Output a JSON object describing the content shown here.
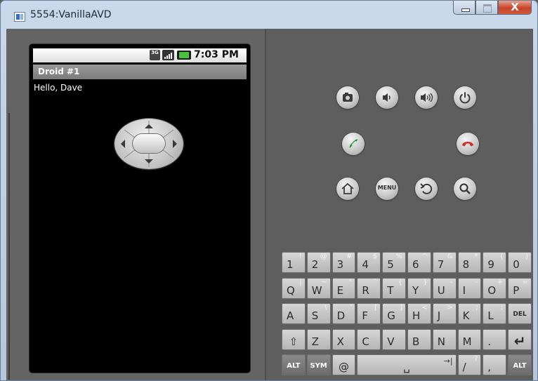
{
  "window": {
    "title": "5554:VanillaAVD",
    "close_glyph": "X",
    "controls": [
      "minimize",
      "maximize",
      "close"
    ]
  },
  "device": {
    "status_bar": {
      "network_badge": "3G",
      "time": "7:03 PM"
    },
    "app_title": "Droid #1",
    "body_text": "Hello, Dave"
  },
  "hardware_buttons": {
    "row1": [
      "camera-icon",
      "volume-down-icon",
      "volume-up-icon",
      "power-icon"
    ],
    "row2": [
      "call-icon",
      "dpad",
      "end-call-icon"
    ],
    "row3": [
      "home-icon",
      "menu-button",
      "back-icon",
      "search-icon"
    ],
    "menu_label": "MENU"
  },
  "keyboard": {
    "row1": [
      {
        "main": "1",
        "alt": "!"
      },
      {
        "main": "2",
        "alt": "@"
      },
      {
        "main": "3",
        "alt": "#"
      },
      {
        "main": "4",
        "alt": "$"
      },
      {
        "main": "5",
        "alt": "%"
      },
      {
        "main": "6",
        "alt": "^"
      },
      {
        "main": "7",
        "alt": "&"
      },
      {
        "main": "8",
        "alt": "*"
      },
      {
        "main": "9",
        "alt": "("
      },
      {
        "main": "0",
        "alt": ")"
      }
    ],
    "row2": [
      {
        "main": "Q",
        "alt": "|"
      },
      {
        "main": "W",
        "alt": "~"
      },
      {
        "main": "E",
        "alt": "\""
      },
      {
        "main": "R",
        "alt": "`"
      },
      {
        "main": "T",
        "alt": "{"
      },
      {
        "main": "Y",
        "alt": "}"
      },
      {
        "main": "U",
        "alt": "-"
      },
      {
        "main": "I",
        "alt": "-"
      },
      {
        "main": "O",
        "alt": "+"
      },
      {
        "main": "P",
        "alt": "="
      }
    ],
    "row3": [
      {
        "main": "A",
        "alt": ""
      },
      {
        "main": "S",
        "alt": "\\"
      },
      {
        "main": "D",
        "alt": "'"
      },
      {
        "main": "F",
        "alt": "["
      },
      {
        "main": "G",
        "alt": "]"
      },
      {
        "main": "H",
        "alt": "<"
      },
      {
        "main": "J",
        "alt": ">"
      },
      {
        "main": "K",
        "alt": ";"
      },
      {
        "main": "L",
        "alt": ":"
      },
      {
        "main": "DEL",
        "alt": ""
      }
    ],
    "row4": [
      {
        "main": "⇧",
        "alt": ""
      },
      {
        "main": "Z",
        "alt": ""
      },
      {
        "main": "X",
        "alt": ""
      },
      {
        "main": "C",
        "alt": ""
      },
      {
        "main": "V",
        "alt": ""
      },
      {
        "main": "B",
        "alt": ""
      },
      {
        "main": "N",
        "alt": ""
      },
      {
        "main": "M",
        "alt": ""
      },
      {
        "main": ".",
        "alt": ""
      },
      {
        "main": "↵",
        "alt": ""
      }
    ],
    "row5": [
      {
        "main": "ALT",
        "alt": ""
      },
      {
        "main": "SYM",
        "alt": ""
      },
      {
        "main": "@",
        "alt": ""
      },
      {
        "main": "␣",
        "alt": "→|"
      },
      {
        "main": "/",
        "alt": "?"
      },
      {
        "main": ",",
        "alt": ""
      },
      {
        "main": "ALT",
        "alt": ""
      }
    ]
  },
  "colors": {
    "call_green": "#1f9a3a",
    "end_call_red": "#d62b22",
    "battery_green": "#48c23d"
  }
}
